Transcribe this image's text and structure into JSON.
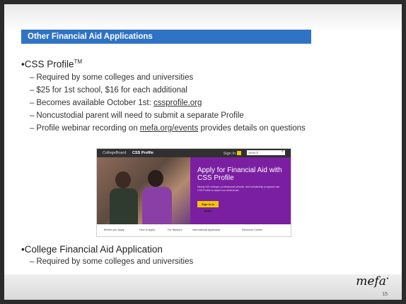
{
  "slide": {
    "title": "Other Financial Aid Applications",
    "bullet1": {
      "text": "•CSS Profile",
      "superscript": "TM",
      "items": [
        {
          "prefix": "Required by some colleges and universities",
          "link": "",
          "suffix": ""
        },
        {
          "prefix": "$25 for 1st school, $16 for each additional",
          "link": "",
          "suffix": ""
        },
        {
          "prefix": "Becomes available October 1st: ",
          "link": "cssprofile.org",
          "suffix": ""
        },
        {
          "prefix": "Noncustodial parent will need to submit a separate Profile",
          "link": "",
          "suffix": ""
        },
        {
          "prefix": "Profile webinar recording on ",
          "link": "mefa.org/events",
          "suffix": " provides details on questions"
        }
      ]
    },
    "bullet2": {
      "text": "•College Financial Aid Application",
      "items": [
        {
          "prefix": "Required by some colleges and universities"
        }
      ]
    },
    "dash": "–",
    "embedded_screenshot": {
      "header_logo": "CollegeBoard",
      "header_brand": "CSS Profile",
      "sign_in": "Sign In",
      "search_placeholder": "Search",
      "hero_title": "Apply for Financial Aid with CSS Profile",
      "hero_desc": "Nearly 400 colleges, professional schools, and scholarship programs use CSS Profile to award non-federal aid.",
      "cta": "Sign In to Apply",
      "nav": [
        "Before you Apply",
        "How to Apply",
        "For Mentors",
        "International Applicants",
        "Resource Center"
      ]
    },
    "footer": {
      "logo": "mefa",
      "page_number": "15"
    }
  }
}
